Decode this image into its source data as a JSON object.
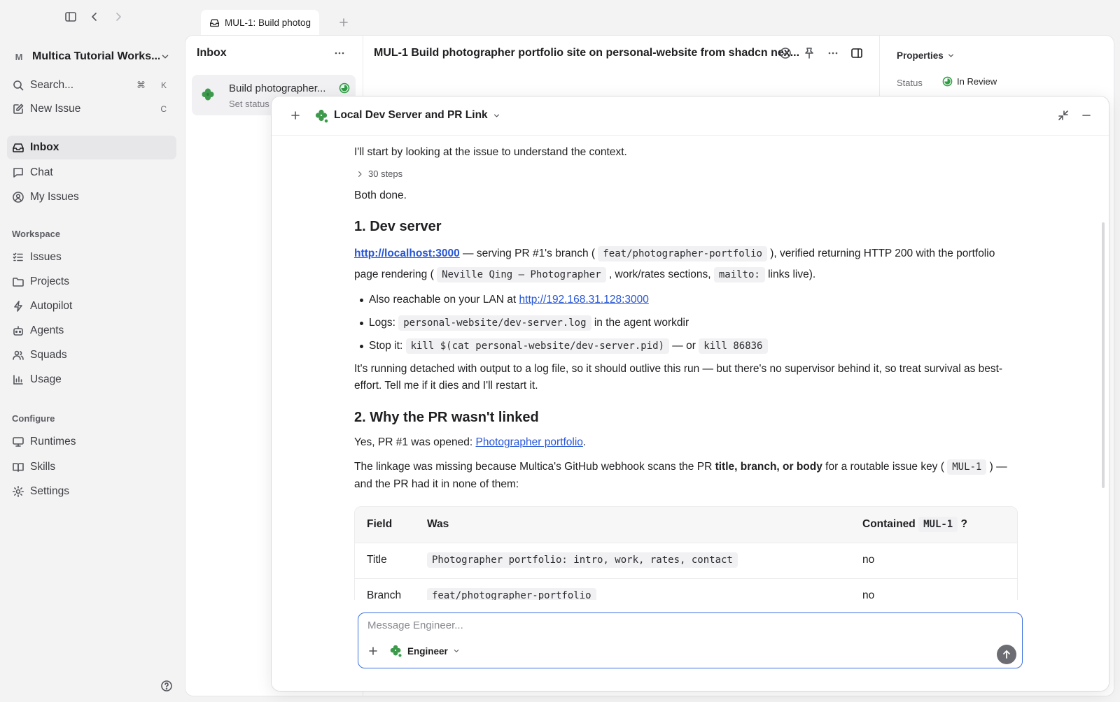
{
  "sidebar": {
    "workspace_mark": "M",
    "workspace_name": "Multica Tutorial Works...",
    "search_label": "Search...",
    "search_kbd_cmd": "⌘",
    "search_kbd_key": "K",
    "new_issue_label": "New Issue",
    "new_issue_kbd": "C",
    "main_items": [
      {
        "label": "Inbox",
        "icon": "inbox-icon"
      },
      {
        "label": "Chat",
        "icon": "chat-icon"
      },
      {
        "label": "My Issues",
        "icon": "user-circle-icon"
      }
    ],
    "workspace_label": "Workspace",
    "workspace_items": [
      {
        "label": "Issues",
        "icon": "list-icon"
      },
      {
        "label": "Projects",
        "icon": "folder-icon"
      },
      {
        "label": "Autopilot",
        "icon": "bolt-icon"
      },
      {
        "label": "Agents",
        "icon": "robot-icon"
      },
      {
        "label": "Squads",
        "icon": "users-icon"
      },
      {
        "label": "Usage",
        "icon": "bar-chart-icon"
      }
    ],
    "configure_label": "Configure",
    "configure_items": [
      {
        "label": "Runtimes",
        "icon": "monitor-icon"
      },
      {
        "label": "Skills",
        "icon": "book-icon"
      },
      {
        "label": "Settings",
        "icon": "gear-icon"
      }
    ]
  },
  "tab": {
    "label": "MUL-1: Build photog"
  },
  "inbox": {
    "title": "Inbox",
    "item_title": "Build photographer...",
    "item_sub": "Set status"
  },
  "issue": {
    "title": "MUL-1 Build photographer portfolio site on personal-website from shadcn nex..."
  },
  "properties": {
    "title": "Properties",
    "status_label": "Status",
    "status_value": "In Review",
    "status_color": "#2f9e44"
  },
  "chat": {
    "title": "Local Dev Server and PR Link",
    "intro": "I'll start by looking at the issue to understand the context.",
    "steps": "30 steps",
    "both_done": "Both done.",
    "h1": "1. Dev server",
    "dev_link": "http://localhost:3000",
    "dev_text1": " — serving PR #1's branch ( ",
    "dev_branch": "feat/photographer-portfolio",
    "dev_text2": " ), verified returning HTTP 200 with the portfolio page rendering ( ",
    "dev_page_title": "Neville Qing — Photographer",
    "dev_text3": " , work/rates sections, ",
    "dev_mailto": "mailto:",
    "dev_text4": " links live).",
    "bullet1_text": "Also reachable on your LAN at ",
    "bullet1_link": "http://192.168.31.128:3000",
    "bullet2_text": "Logs: ",
    "bullet2_code": "personal-website/dev-server.log",
    "bullet2_tail": " in the agent workdir",
    "bullet3_text": "Stop it: ",
    "bullet3_code1": "kill $(cat personal-website/dev-server.pid)",
    "bullet3_mid": " — or ",
    "bullet3_code2": "kill 86836",
    "detached": "It's running detached with output to a log file, so it should outlive this run — but there's no supervisor behind it, so treat survival as best-effort. Tell me if it dies and I'll restart it.",
    "h2": "2. Why the PR wasn't linked",
    "pr_text": "Yes, PR #1 was opened: ",
    "pr_link": "Photographer portfolio",
    "pr_dot": ".",
    "linkage_1": "The linkage was missing because Multica's GitHub webhook scans the PR ",
    "linkage_bold": "title, branch, or body",
    "linkage_2": " for a routable issue key ( ",
    "linkage_code": "MUL-1",
    "linkage_3": " ) — and the PR had it in none of them:",
    "table": {
      "h_field": "Field",
      "h_was": "Was",
      "h_contained": "Contained ",
      "h_contained_code": "MUL-1",
      "h_contained_q": " ?",
      "rows": [
        {
          "field": "Title",
          "was": "Photographer portfolio: intro, work, rates, contact",
          "contained": "no"
        },
        {
          "field": "Branch",
          "was": "feat/photographer-portfolio",
          "contained": "no"
        }
      ]
    },
    "composer_placeholder": "Message Engineer...",
    "agent_name": "Engineer"
  },
  "colors": {
    "accent": "#2756d6",
    "focus_border": "#3b6fe0",
    "status_green": "#2f9e44"
  }
}
